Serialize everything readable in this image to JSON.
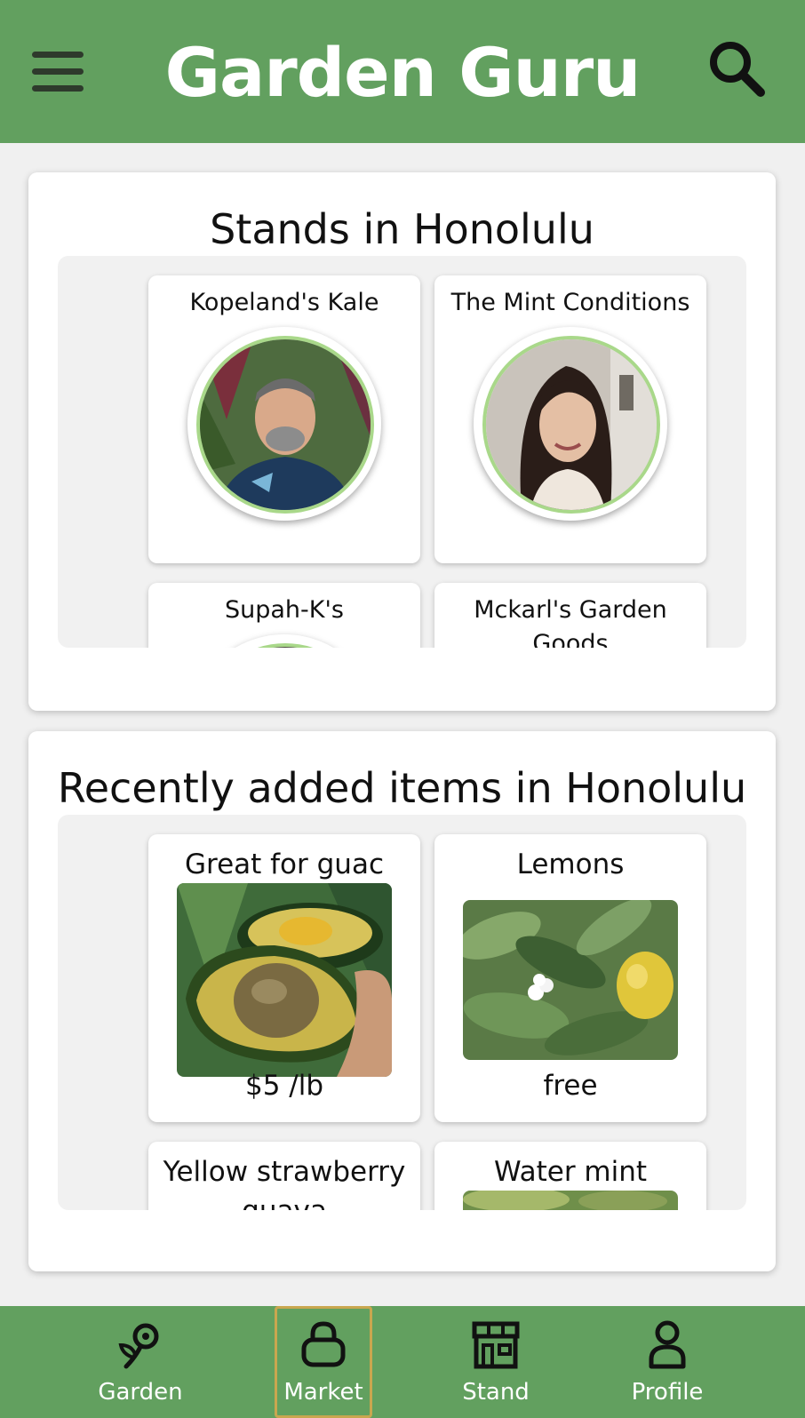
{
  "header": {
    "title": "Garden Guru"
  },
  "stands": {
    "title": "Stands in Honolulu",
    "items": [
      {
        "name": "Kopeland's Kale"
      },
      {
        "name": "The Mint Conditions"
      },
      {
        "name": "Supah-K's"
      },
      {
        "name": "Mckarl's Garden Goods"
      }
    ]
  },
  "recent": {
    "title": "Recently added items in Honolulu",
    "items": [
      {
        "name": "Great for guac",
        "price": "$5 /lb"
      },
      {
        "name": "Lemons",
        "price": "free"
      },
      {
        "name": "Yellow strawberry guava",
        "price": ""
      },
      {
        "name": "Water mint",
        "price": ""
      }
    ]
  },
  "nav": {
    "items": [
      {
        "label": "Garden",
        "icon": "flower-icon"
      },
      {
        "label": "Market",
        "icon": "shopping-bag-icon",
        "active": true
      },
      {
        "label": "Stand",
        "icon": "storefront-icon"
      },
      {
        "label": "Profile",
        "icon": "person-icon"
      }
    ]
  },
  "colors": {
    "brand": "#62a05f",
    "avatar_ring": "#a9d88a",
    "active_outline": "#c9a74f",
    "background": "#f0f0f0"
  }
}
